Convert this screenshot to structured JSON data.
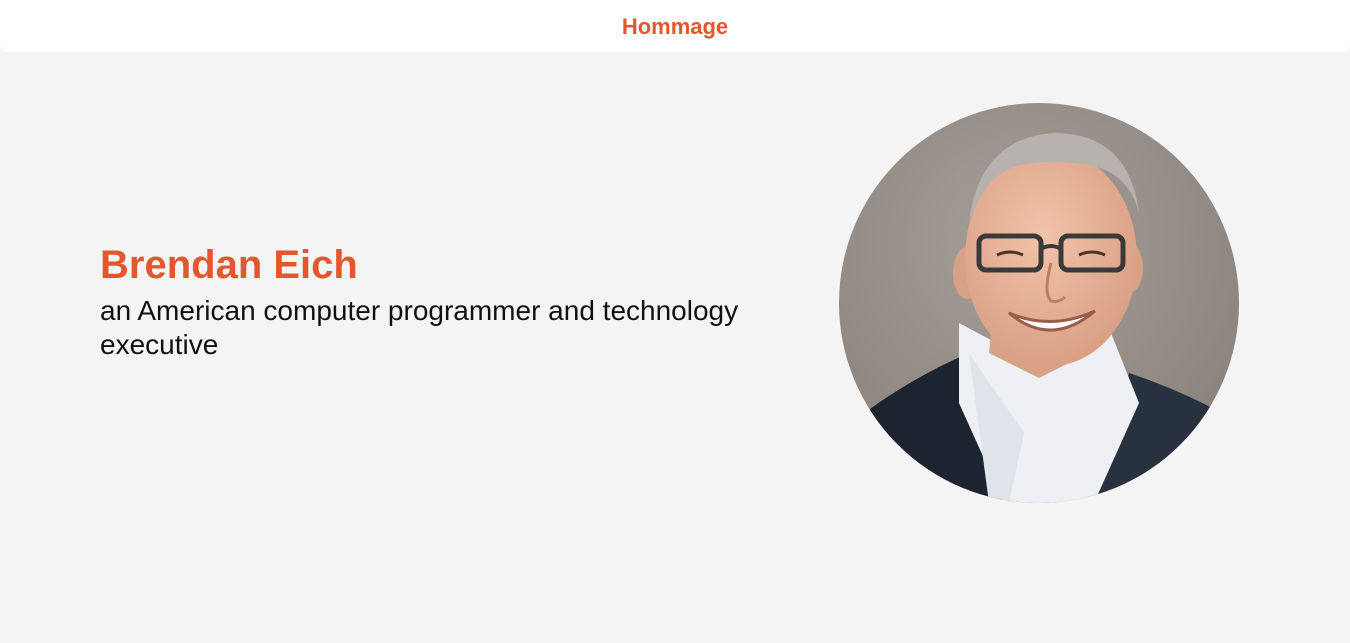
{
  "header": {
    "brand_label": "Hommage"
  },
  "hero": {
    "name": "Brendan Eich",
    "tagline": "an American computer programmer and technology executive"
  },
  "colors": {
    "accent": "#e4572e",
    "background": "#f4f4f4",
    "header_bg": "#ffffff",
    "text": "#111111"
  }
}
